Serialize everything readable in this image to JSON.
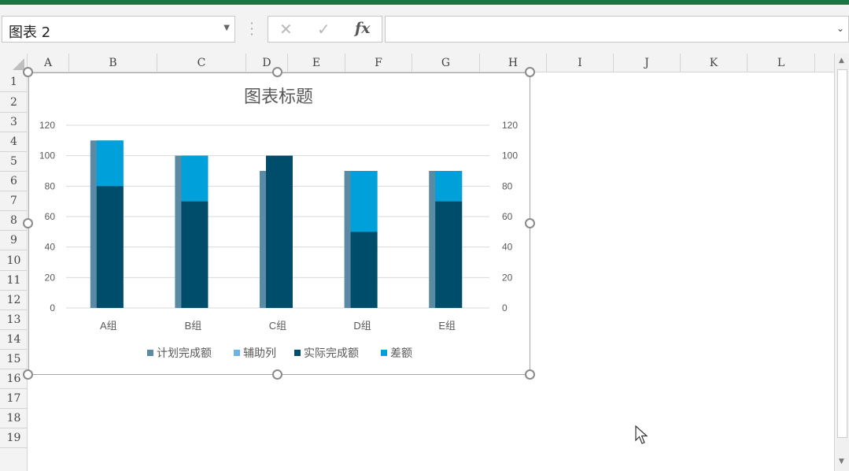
{
  "name_box": {
    "value": "图表 2"
  },
  "formula_bar": {
    "cancel_glyph": "✕",
    "enter_glyph": "✓",
    "fx_label": "fx",
    "value": ""
  },
  "columns": [
    "A",
    "B",
    "C",
    "D",
    "E",
    "F",
    "G",
    "H",
    "I",
    "J",
    "K",
    "L"
  ],
  "rows": [
    "1",
    "2",
    "3",
    "4",
    "5",
    "6",
    "7",
    "8",
    "9",
    "10",
    "11",
    "12",
    "13",
    "14",
    "15",
    "16",
    "17",
    "18",
    "19"
  ],
  "colors": {
    "plan": "#5b8ba4",
    "aux": "#6cb4e4",
    "actual": "#004c6b",
    "diff": "#00a0db",
    "accent": "#217346"
  },
  "chart_data": {
    "type": "bar",
    "title": "图表标题",
    "categories": [
      "A组",
      "B组",
      "C组",
      "D组",
      "E组"
    ],
    "series": [
      {
        "name": "计划完成额",
        "values": [
          110,
          100,
          90,
          90,
          90
        ]
      },
      {
        "name": "辅助列",
        "values": [
          0,
          0,
          0,
          0,
          0
        ]
      },
      {
        "name": "实际完成额",
        "values": [
          80,
          70,
          100,
          50,
          70
        ]
      },
      {
        "name": "差额",
        "values": [
          30,
          30,
          0,
          40,
          20
        ]
      }
    ],
    "ylim": [
      0,
      120
    ],
    "yticks": [
      0,
      20,
      40,
      60,
      80,
      100,
      120
    ],
    "secondary_ylim": [
      0,
      120
    ],
    "grid": true,
    "legend": "bottom"
  }
}
